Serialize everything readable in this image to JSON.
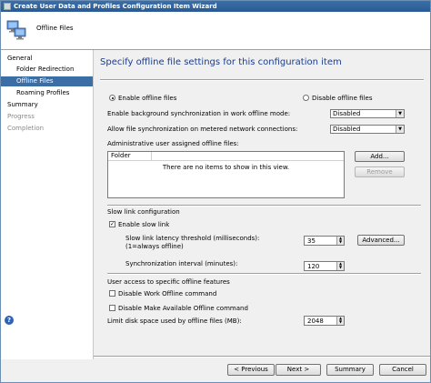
{
  "window": {
    "title": "Create User Data and Profiles Configuration Item Wizard"
  },
  "header": {
    "title": "Offline Files",
    "icon": "computer-icon"
  },
  "nav": {
    "items": [
      {
        "label": "General",
        "state": "normal",
        "level": 1
      },
      {
        "label": "Folder Redirection",
        "state": "normal",
        "level": 2
      },
      {
        "label": "Offline Files",
        "state": "selected",
        "level": 2
      },
      {
        "label": "Roaming Profiles",
        "state": "normal",
        "level": 2
      },
      {
        "label": "Summary",
        "state": "normal",
        "level": 1
      },
      {
        "label": "Progress",
        "state": "disabled",
        "level": 1
      },
      {
        "label": "Completion",
        "state": "disabled",
        "level": 1
      }
    ]
  },
  "page": {
    "title": "Specify offline file settings for this configuration item",
    "enable_label": "Enable offline files",
    "disable_label": "Disable offline files",
    "enable_selected": true,
    "bg_sync": {
      "label": "Enable background synchronization in work offline mode:",
      "value": "Disabled"
    },
    "metered_sync": {
      "label": "Allow file synchronization on metered network connections:",
      "value": "Disabled"
    },
    "admin_files": {
      "label": "Administrative user assigned offline files:",
      "column": "Folder",
      "empty_text": "There are no items to show in this view.",
      "add_label": "Add...",
      "remove_label": "Remove"
    },
    "slow_link": {
      "section": "Slow link configuration",
      "enable_label": "Enable slow link",
      "enable_checked": true,
      "latency_label_1": "Slow link latency threshold (milliseconds):",
      "latency_label_2": "(1=always offline)",
      "latency_value": "35",
      "advanced_label": "Advanced...",
      "sync_label": "Synchronization interval (minutes):",
      "sync_value": "120"
    },
    "access": {
      "section": "User access to specific offline features",
      "work_offline_label": "Disable Work Offline command",
      "make_available_label": "Disable Make Available Offline command",
      "disk_label": "Limit disk space used by offline files (MB):",
      "disk_value": "2048"
    }
  },
  "footer": {
    "previous_label": "< Previous",
    "next_label": "Next >",
    "summary_label": "Summary",
    "cancel_label": "Cancel"
  },
  "colors": {
    "accent": "#3a6ea5",
    "title_text": "#1a3c8c"
  }
}
